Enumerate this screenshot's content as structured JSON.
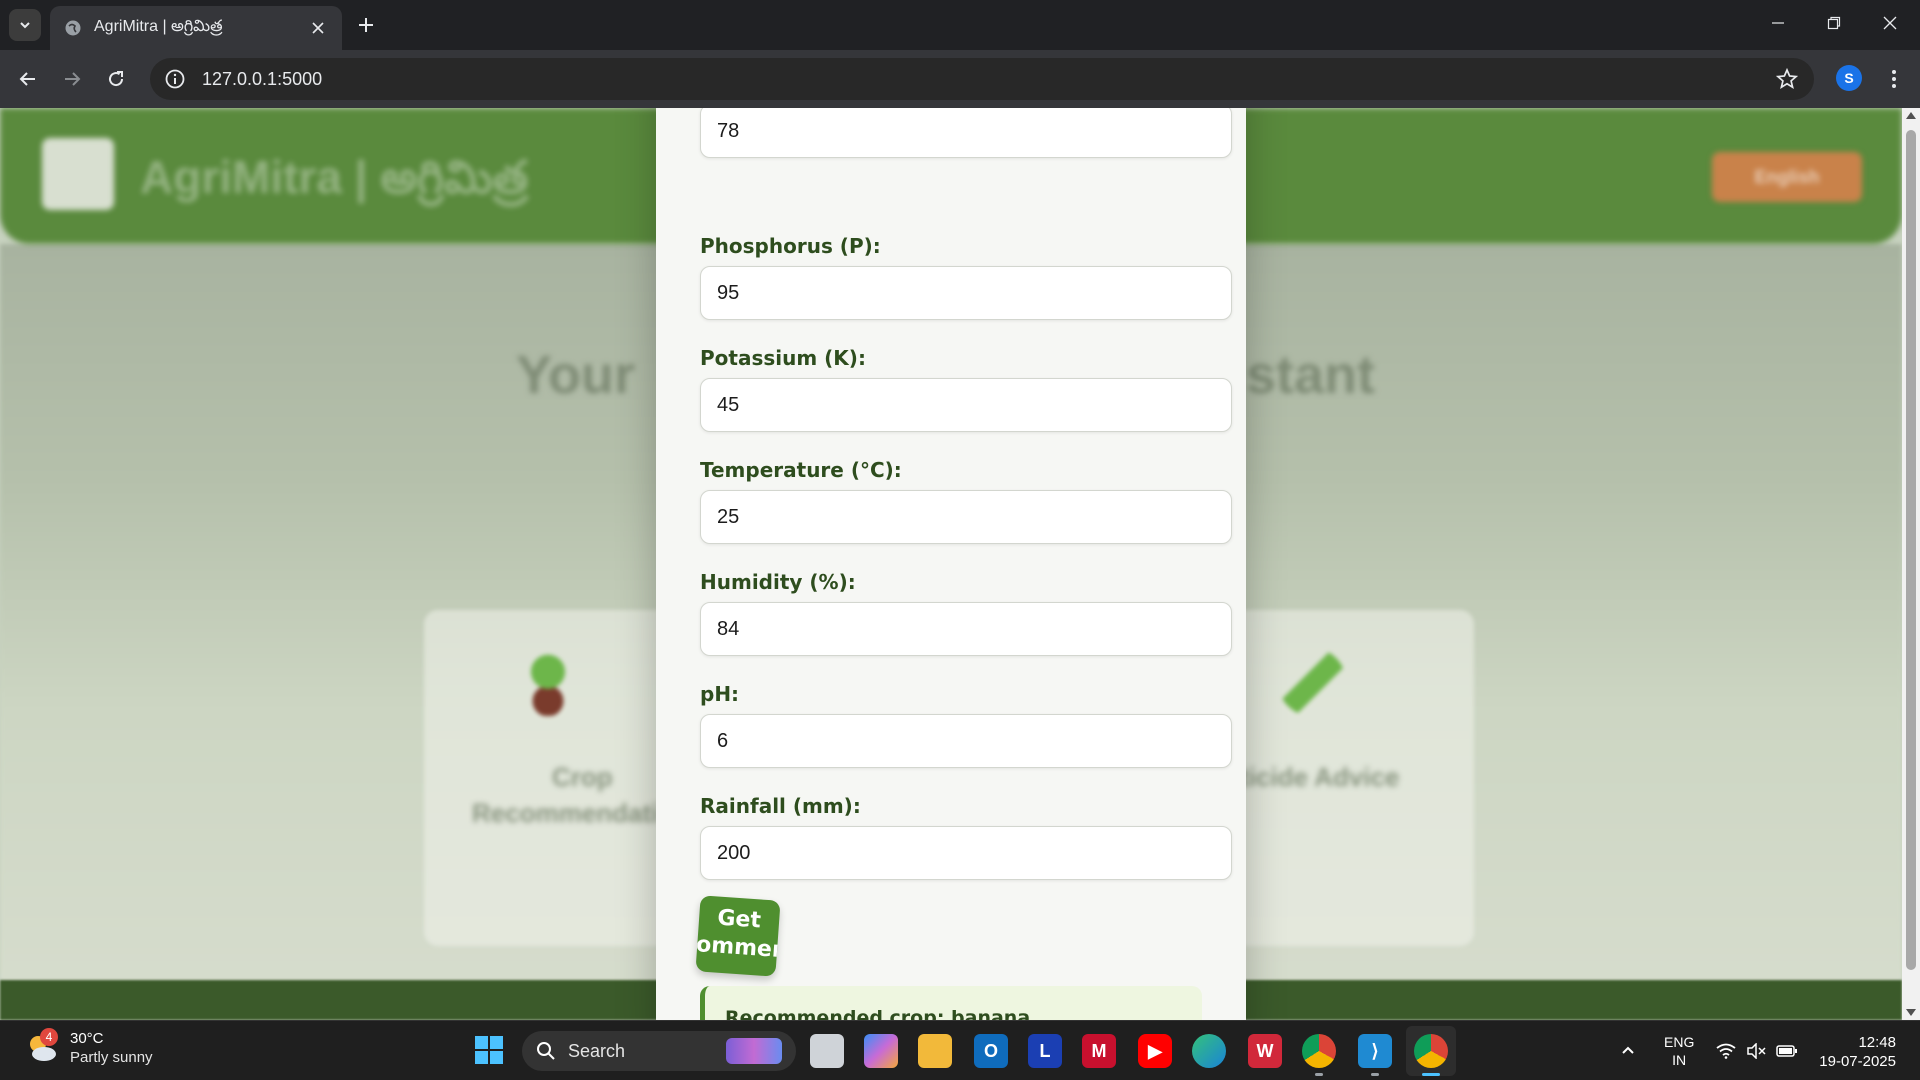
{
  "browser": {
    "tab_title": "AgriMitra | అగ్రిమిత్ర",
    "url": "127.0.0.1:5000",
    "profile_initial": "S"
  },
  "page_background": {
    "brand": "AgriMitra | అగ్రిమిత్ర",
    "hero_left": "Your",
    "hero_right": "stant",
    "card1_title_a": "Crop",
    "card1_title_b": "Recommendati",
    "card3_title": "ticide Advice"
  },
  "form": {
    "fields": [
      {
        "label": "",
        "value": "78"
      },
      {
        "label": "Phosphorus (P):",
        "value": "95"
      },
      {
        "label": "Potassium (K):",
        "value": "45"
      },
      {
        "label": "Temperature (°C):",
        "value": "25"
      },
      {
        "label": "Humidity (%):",
        "value": "84"
      },
      {
        "label": "pH:",
        "value": "6"
      },
      {
        "label": "Rainfall (mm):",
        "value": "200"
      }
    ],
    "submit_label": "Get Recommendation",
    "result_text": "Recommended crop: banana"
  },
  "taskbar": {
    "weather_temp": "30°C",
    "weather_condition": "Partly sunny",
    "weather_badge": "4",
    "search_label": "Search",
    "language_top": "ENG",
    "language_bottom": "IN",
    "time": "12:48",
    "date": "19-07-2025"
  },
  "colors": {
    "brand_green": "#4f8f2f",
    "label_green": "#2e4d1e",
    "result_bg": "#eef6e0"
  }
}
